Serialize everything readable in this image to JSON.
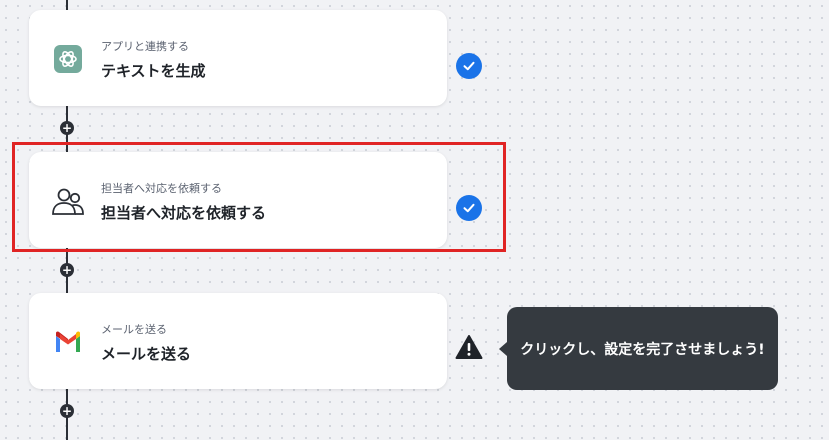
{
  "colors": {
    "accent_blue": "#1a73e8",
    "highlight_red": "#e02424",
    "tooltip_bg": "#353a40",
    "line": "#2b2f36"
  },
  "flow": {
    "add_label": "+",
    "steps": [
      {
        "subtitle": "アプリと連携する",
        "title": "テキストを生成",
        "icon": "chatgpt-icon",
        "status": "complete"
      },
      {
        "subtitle": "担当者へ対応を依頼する",
        "title": "担当者へ対応を依頼する",
        "icon": "people-icon",
        "status": "complete"
      },
      {
        "subtitle": "メールを送る",
        "title": "メールを送る",
        "icon": "gmail-icon",
        "status": "warning"
      }
    ]
  },
  "tooltip": {
    "text": "クリックし、設定を完了させましょう!"
  }
}
